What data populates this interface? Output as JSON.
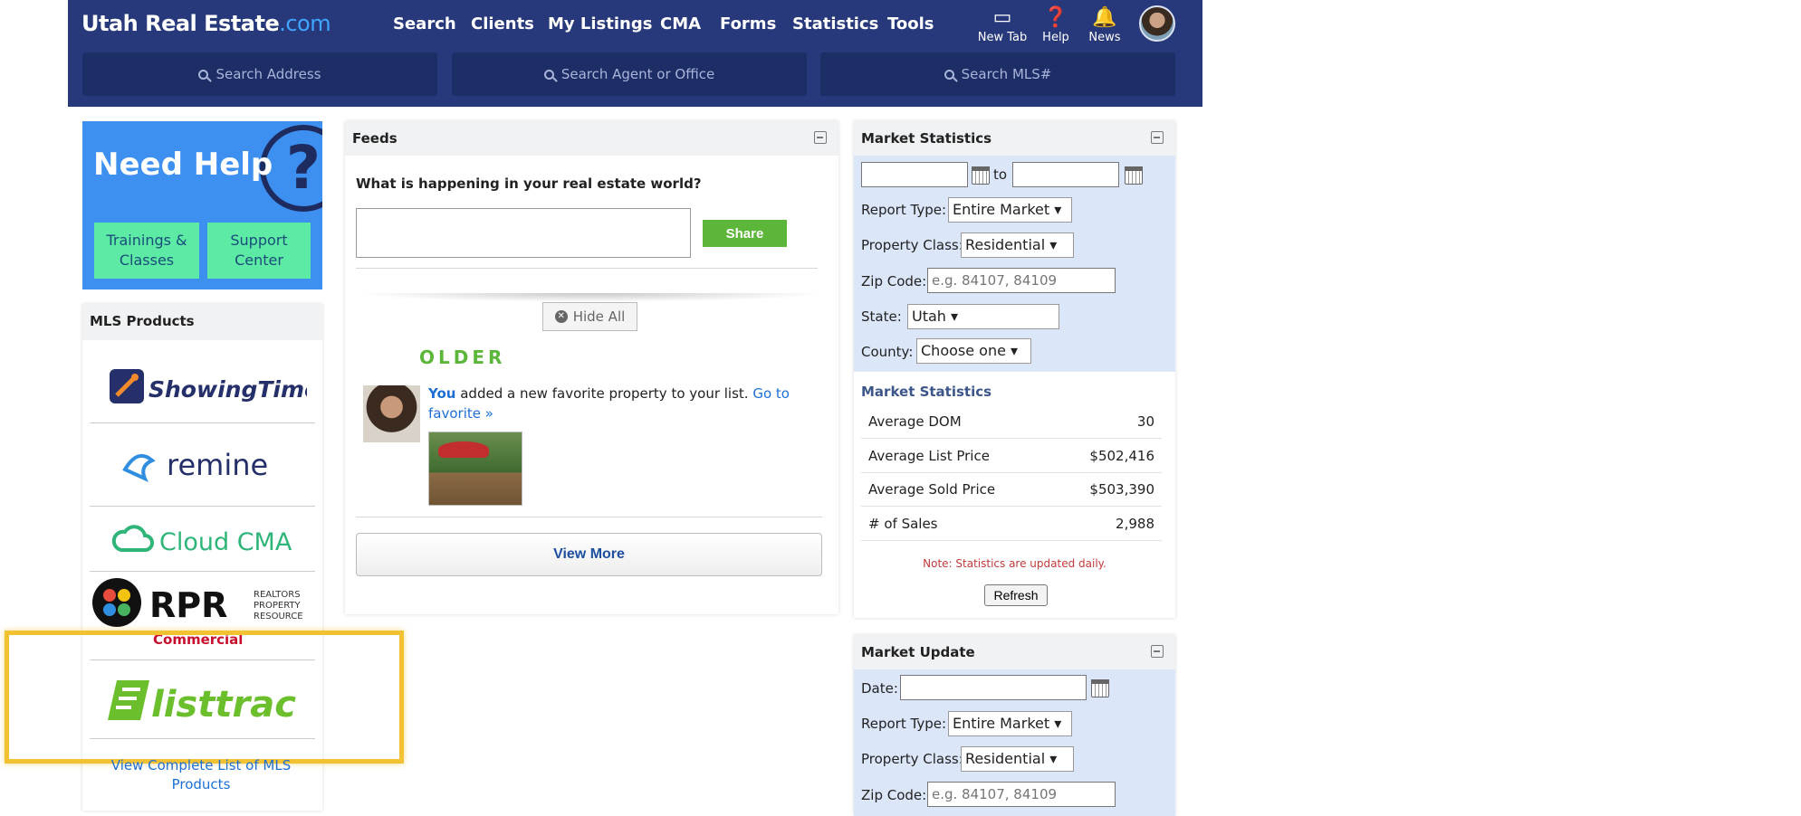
{
  "header": {
    "logo": "Utah Real Estate",
    "logo_suffix": ".com",
    "nav": [
      "Search",
      "Clients",
      "My Listings",
      "CMA",
      "Forms",
      "Statistics",
      "Tools"
    ],
    "icons": [
      {
        "label": "New Tab",
        "icon": "new-tab-icon"
      },
      {
        "label": "Help",
        "icon": "help-icon"
      },
      {
        "label": "News",
        "icon": "bell-icon"
      }
    ],
    "search": {
      "address_placeholder": "Search Address",
      "agent_placeholder": "Search Agent or Office",
      "mls_placeholder": "Search MLS#"
    }
  },
  "need_help": {
    "title": "Need Help",
    "trainings": "Trainings & Classes",
    "support": "Support Center"
  },
  "mls_products": {
    "title": "MLS Products",
    "items": [
      {
        "name": "ShowingTime"
      },
      {
        "name": "remine"
      },
      {
        "name": "Cloud CMA"
      },
      {
        "name": "RPR",
        "sub": "REALTORS PROPERTY RESOURCE",
        "tag": "Commercial"
      },
      {
        "name": "listtrac"
      }
    ],
    "view_list": "View Complete List of MLS Products"
  },
  "feeds": {
    "title": "Feeds",
    "question": "What is happening in your real estate world?",
    "share": "Share",
    "hide_all": "Hide All",
    "older": "OLDER",
    "item": {
      "you": "You",
      "text": " added a new favorite property to your list. ",
      "link": "Go to favorite »"
    },
    "view_more": "View More"
  },
  "market_statistics": {
    "title": "Market Statistics",
    "to": "to",
    "report_type_label": "Report Type:",
    "report_type": "Entire Market",
    "property_class_label": "Property Class:",
    "property_class": "Residential",
    "zip_label": "Zip Code:",
    "zip_placeholder": "e.g. 84107, 84109",
    "state_label": "State:",
    "state": "Utah",
    "county_label": "County:",
    "county": "Choose one",
    "subtitle": "Market Statistics",
    "rows": [
      {
        "label": "Average DOM",
        "value": "30"
      },
      {
        "label": "Average List Price",
        "value": "$502,416"
      },
      {
        "label": "Average Sold Price",
        "value": "$503,390"
      },
      {
        "label": "# of Sales",
        "value": "2,988"
      }
    ],
    "note": "Note: Statistics are updated daily.",
    "refresh": "Refresh"
  },
  "market_update": {
    "title": "Market Update",
    "date_label": "Date:",
    "report_type_label": "Report Type:",
    "report_type": "Entire Market",
    "property_class_label": "Property Class:",
    "property_class": "Residential",
    "zip_label": "Zip Code:",
    "zip_placeholder": "e.g. 84107, 84109"
  }
}
